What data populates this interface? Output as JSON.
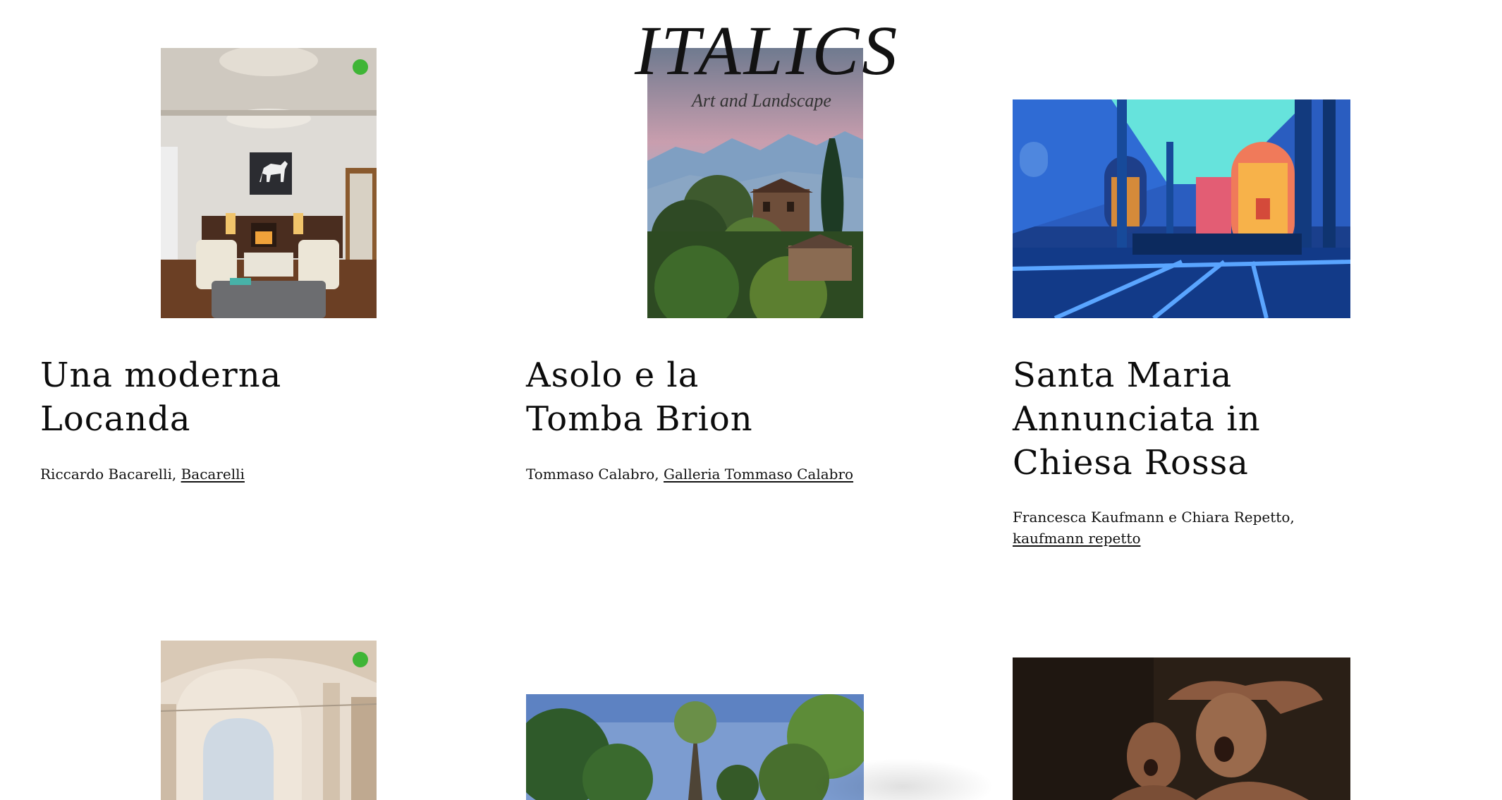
{
  "site": {
    "logo": "ITALICS",
    "tagline": "Art and Landscape"
  },
  "cards": [
    {
      "title": "Una moderna Locanda",
      "byline_text": "Riccardo Bacarelli, ",
      "byline_link": "Bacarelli",
      "image": "living-room-interior",
      "badge": true
    },
    {
      "title": "Asolo e la Tomba Brion",
      "byline_text": "Tommaso Calabro, ",
      "byline_link": "Galleria Tommaso Calabro",
      "image": "villa-landscape-mountains",
      "badge": false
    },
    {
      "title": "Santa Maria Annunciata in Chiesa Rossa",
      "byline_text": "Francesca Kaufmann e Chiara Repetto, ",
      "byline_link": "kaufmann repetto",
      "image": "church-light-installation",
      "badge": false
    },
    {
      "image": "cloister-arches",
      "badge": true
    },
    {
      "image": "tree-lined-park",
      "badge": false
    },
    {
      "image": "terracotta-sculpture",
      "badge": false
    }
  ],
  "colors": {
    "badge": "#3fb536",
    "text": "#111111",
    "background": "#ffffff"
  }
}
